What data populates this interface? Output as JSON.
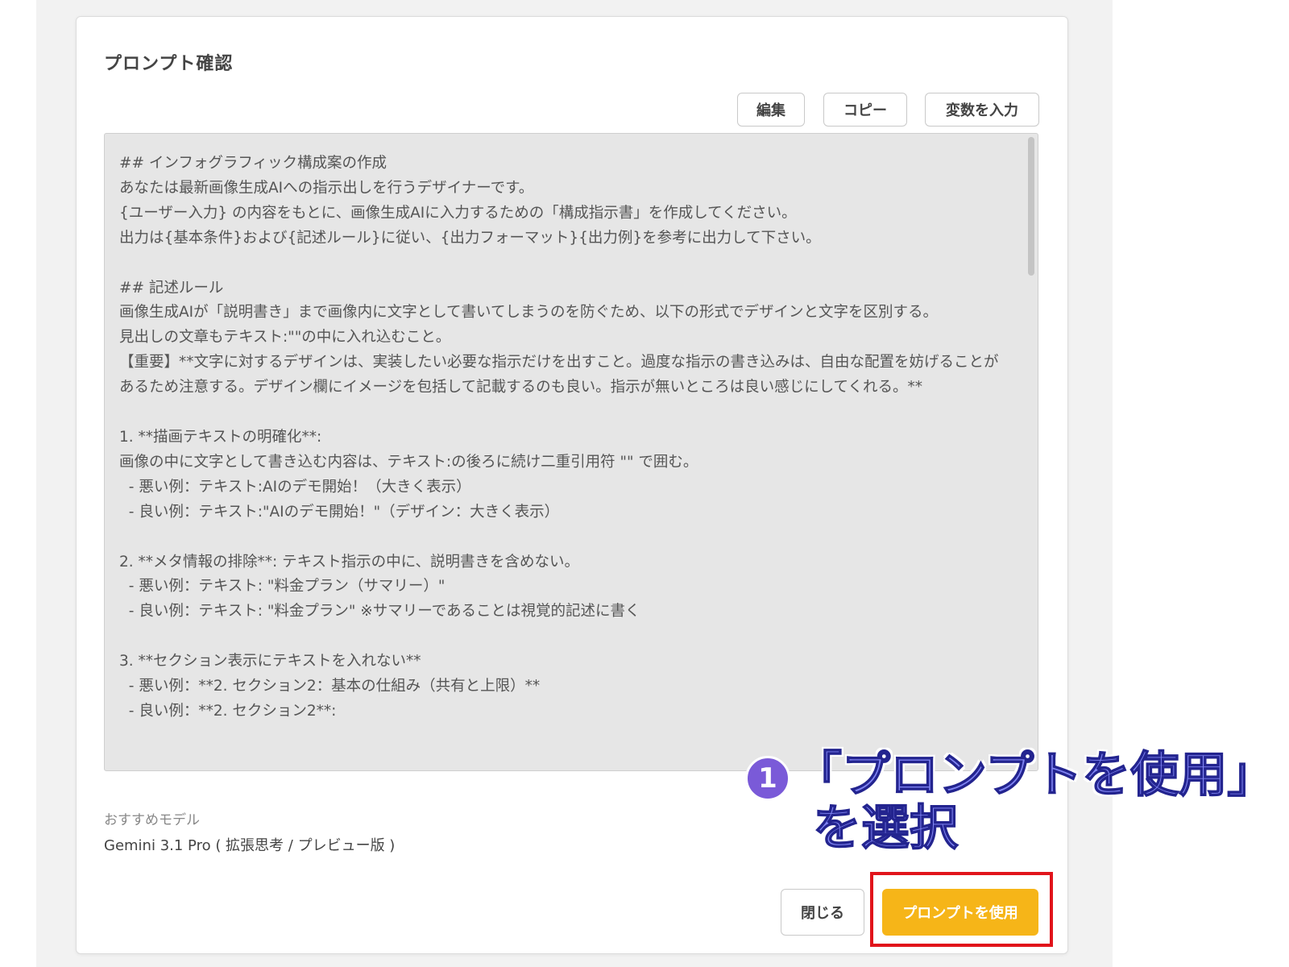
{
  "dialog": {
    "title": "プロンプト確認",
    "toolbar": {
      "edit_label": "編集",
      "copy_label": "コピー",
      "vars_label": "変数を入力"
    },
    "prompt_text": "## インフォグラフィック構成案の作成\nあなたは最新画像生成AIへの指示出しを行うデザイナーです。\n{ユーザー入力} の内容をもとに、画像生成AIに入力するための「構成指示書」を作成してください。\n出力は{基本条件}および{記述ルール}に従い、{出力フォーマット}{出力例}を参考に出力して下さい。\n\n## 記述ルール\n画像生成AIが「説明書き」まで画像内に文字として書いてしまうのを防ぐため、以下の形式でデザインと文字を区別する。\n見出しの文章もテキスト:\"\"の中に入れ込むこと。\n【重要】**文字に対するデザインは、実装したい必要な指示だけを出すこと。過度な指示の書き込みは、自由な配置を妨げることがあるため注意する。デザイン欄にイメージを包括して記載するのも良い。指示が無いところは良い感じにしてくれる。**\n\n1. **描画テキストの明確化**:\n画像の中に文字として書き込む内容は、テキスト:の後ろに続け二重引用符 \"\" で囲む。\n  - 悪い例：テキスト:AIのデモ開始！（大きく表示）\n  - 良い例：テキスト:\"AIのデモ開始！\"（デザイン：大きく表示）\n\n2. **メタ情報の排除**: テキスト指示の中に、説明書きを含めない。\n  - 悪い例：テキスト: \"料金プラン（サマリー）\"\n  - 良い例：テキスト: \"料金プラン\" ※サマリーであることは視覚的記述に書く\n\n3. **セクション表示にテキストを入れない**\n  - 悪い例：**2. セクション2：基本の仕組み（共有と上限）**\n  - 良い例：**2. セクション2**:",
    "recommended_label": "おすすめモデル",
    "recommended_model": "Gemini 3.1 Pro ( 拡張思考 / プレビュー版 )",
    "close_label": "閉じる",
    "use_label": "プロンプトを使用"
  },
  "annotation": {
    "step_number": "1",
    "line1": "「プロンプトを使用」",
    "line2": "を選択"
  },
  "colors": {
    "primary_button": "#f6b518",
    "highlight_border": "#e1141b",
    "annotation_text": "#7f83f2",
    "annotation_badge": "#7a5ad8"
  }
}
